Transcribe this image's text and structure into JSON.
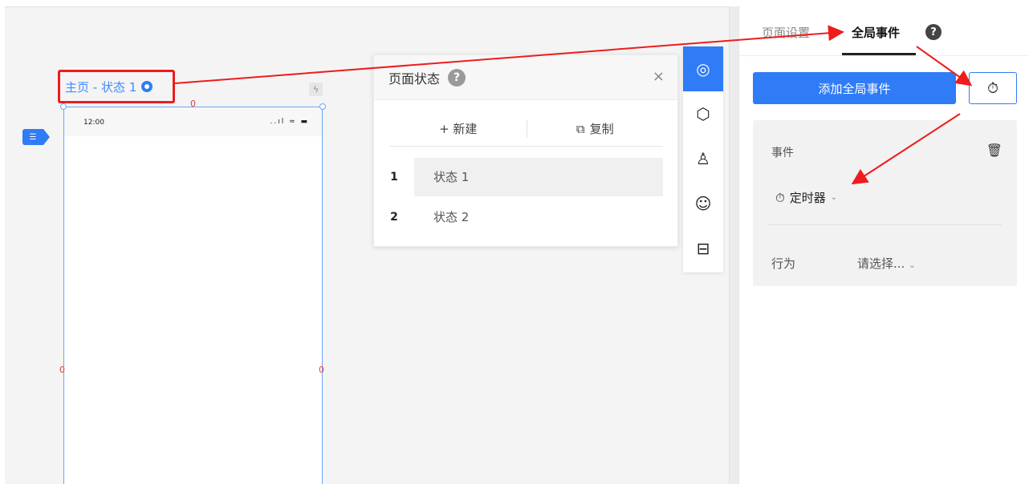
{
  "canvas": {
    "page_label": "主页 - 状态 1",
    "phone": {
      "time": "12:00",
      "status_icons": "..ıl ≈ ▬"
    }
  },
  "state_panel": {
    "title": "页面状态",
    "help": "?",
    "close": "×",
    "new_label": "+ 新建",
    "copy_label": "复制",
    "states": [
      {
        "num": "1",
        "name": "状态 1",
        "selected": true
      },
      {
        "num": "2",
        "name": "状态 2",
        "selected": false
      }
    ]
  },
  "toolbar": {
    "items": [
      "target-icon",
      "hexagon-icon",
      "user-icon",
      "smiley-icon",
      "layout-icon"
    ]
  },
  "right_panel": {
    "tabs": [
      "页面设置",
      "全局事件"
    ],
    "active_tab": "全局事件",
    "help": "?",
    "add_button": "添加全局事件",
    "event": {
      "label": "事件",
      "timer_label": "定时器",
      "action_label": "行为",
      "action_select": "请选择..."
    }
  },
  "colors": {
    "accent": "#2f7cf6",
    "annotation": "#ee1c1c"
  }
}
